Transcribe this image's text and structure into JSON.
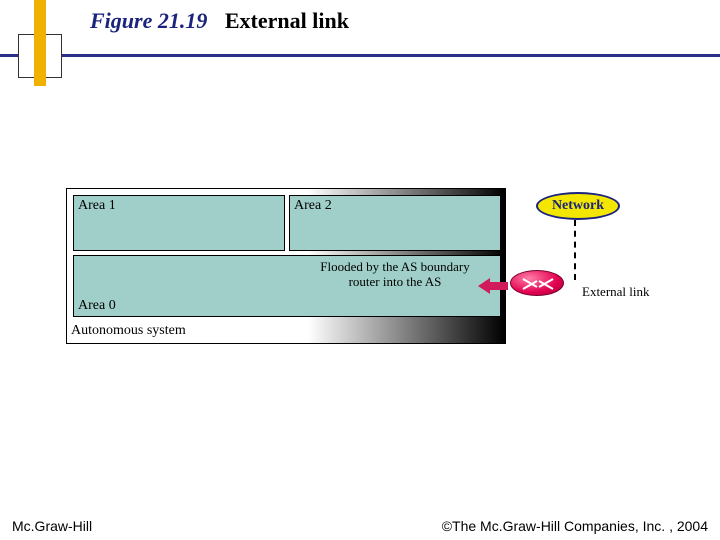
{
  "title": {
    "figure_label": "Figure 21.19",
    "text": "External link"
  },
  "diagram": {
    "autonomous_system_label": "Autonomous system",
    "areas": {
      "area1": "Area 1",
      "area2": "Area 2",
      "area0": "Area 0"
    },
    "flood_text": "Flooded by the AS boundary router into the AS",
    "external_link_label": "External link",
    "network_label": "Network",
    "icons": {
      "router": "router-icon",
      "arrow_left": "arrow-left-icon"
    }
  },
  "footer": {
    "left": "Mc.Graw-Hill",
    "right": "©The Mc.Graw-Hill Companies, Inc. , 2004"
  }
}
